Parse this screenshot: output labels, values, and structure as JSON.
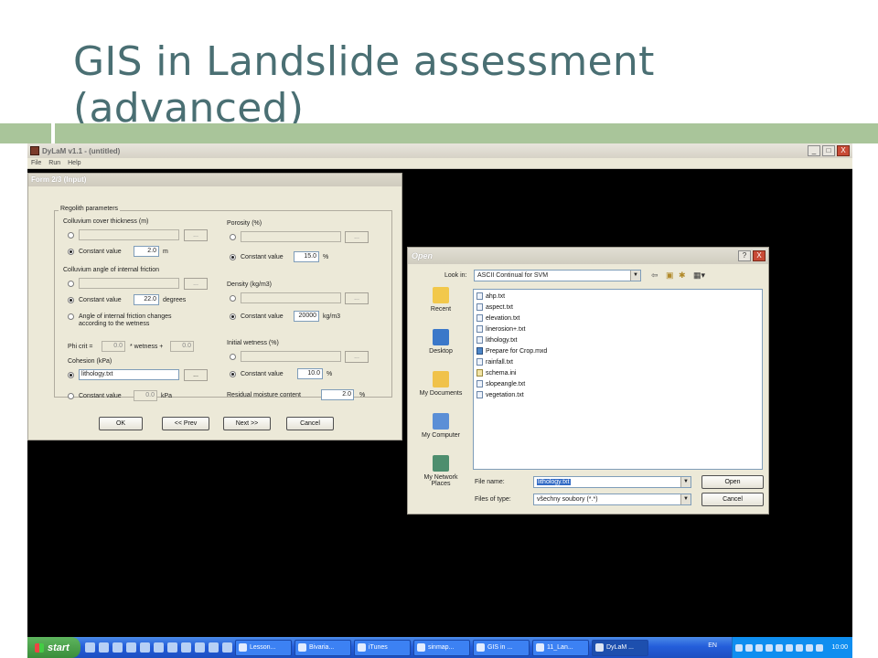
{
  "slide": {
    "title": "GIS in Landslide assessment (advanced)"
  },
  "app": {
    "window_title": "DyLaM v1.1 - (untitled)",
    "menu": [
      "File",
      "Run",
      "Help"
    ],
    "window_buttons": [
      "_",
      "□",
      "X"
    ]
  },
  "form": {
    "title": "Form 2/3 (Input)",
    "group_label": "Regolith parameters",
    "colluvium_thickness": {
      "label": "Colluvium cover thickness (m)",
      "constant_label": "Constant value",
      "value": "2.0",
      "unit": "m",
      "selected": "constant"
    },
    "colluvium_friction": {
      "label": "Colluvium angle of internal friction",
      "constant_label": "Constant value",
      "value": "22.0",
      "unit": "degrees",
      "alt_option_line1": "Angle of internal friction changes",
      "alt_option_line2": "according to the wetness",
      "selected": "constant"
    },
    "phi": {
      "phi_crit_label": "Phi crit =",
      "phi_crit_value": "0.0",
      "wetness_label": "* wetness +",
      "wetness_value": "0.0"
    },
    "cohesion": {
      "label": "Cohesion (kPa)",
      "file_value": "lithology.txt",
      "constant_label": "Constant value",
      "constant_value": "0.0",
      "unit": "kPa",
      "selected": "file"
    },
    "porosity": {
      "label": "Porosity (%)",
      "constant_label": "Constant value",
      "value": "15.0",
      "unit": "%",
      "selected": "constant"
    },
    "density": {
      "label": "Density (kg/m3)",
      "constant_label": "Constant value",
      "value": "20000",
      "unit": "kg/m3",
      "selected": "constant"
    },
    "initial_wetness": {
      "label": "Initial wetness (%)",
      "constant_label": "Constant value",
      "value": "10.0",
      "unit": "%",
      "selected": "constant"
    },
    "residual_moisture": {
      "label": "Residual moisture content",
      "value": "2.0",
      "unit": "%"
    },
    "browse_label": "...",
    "buttons": {
      "ok": "OK",
      "prev": "<< Prev",
      "next": "Next >>",
      "cancel": "Cancel"
    }
  },
  "open_dialog": {
    "title": "Open",
    "title_buttons": [
      "?",
      "X"
    ],
    "look_in_label": "Look in:",
    "look_in_value": "ASCII Continual for SVM",
    "places": [
      "Recent",
      "Desktop",
      "My Documents",
      "My Computer",
      "My Network Places"
    ],
    "files": [
      {
        "name": "ahp.txt",
        "type": "txt"
      },
      {
        "name": "aspect.txt",
        "type": "txt"
      },
      {
        "name": "elevation.txt",
        "type": "txt"
      },
      {
        "name": "linerosion+.txt",
        "type": "txt"
      },
      {
        "name": "lithology.txt",
        "type": "txt"
      },
      {
        "name": "Prepare for Crop.mxd",
        "type": "mxd"
      },
      {
        "name": "rainfall.txt",
        "type": "txt"
      },
      {
        "name": "schema.ini",
        "type": "ini"
      },
      {
        "name": "slopeangle.txt",
        "type": "txt"
      },
      {
        "name": "vegetation.txt",
        "type": "txt"
      }
    ],
    "file_name_label": "File name:",
    "file_name_value": "lithology.txt",
    "files_of_type_label": "Files of type:",
    "files_of_type_value": "všechny soubory (*.*)",
    "open_button": "Open",
    "cancel_button": "Cancel"
  },
  "taskbar": {
    "start_label": "start",
    "tasks": [
      "Lesson...",
      "Bivaria...",
      "iTunes",
      "sinmap...",
      "GIS in ...",
      "11_Lan...",
      "DyLaM ..."
    ],
    "active_task": "DyLaM ...",
    "language": "EN",
    "clock": "10:00"
  },
  "colors": {
    "title_text": "#4a6f73",
    "accent_bar": "#a9c59a",
    "taskbar_blue": "#245edb",
    "start_green": "#3a8d3a"
  }
}
